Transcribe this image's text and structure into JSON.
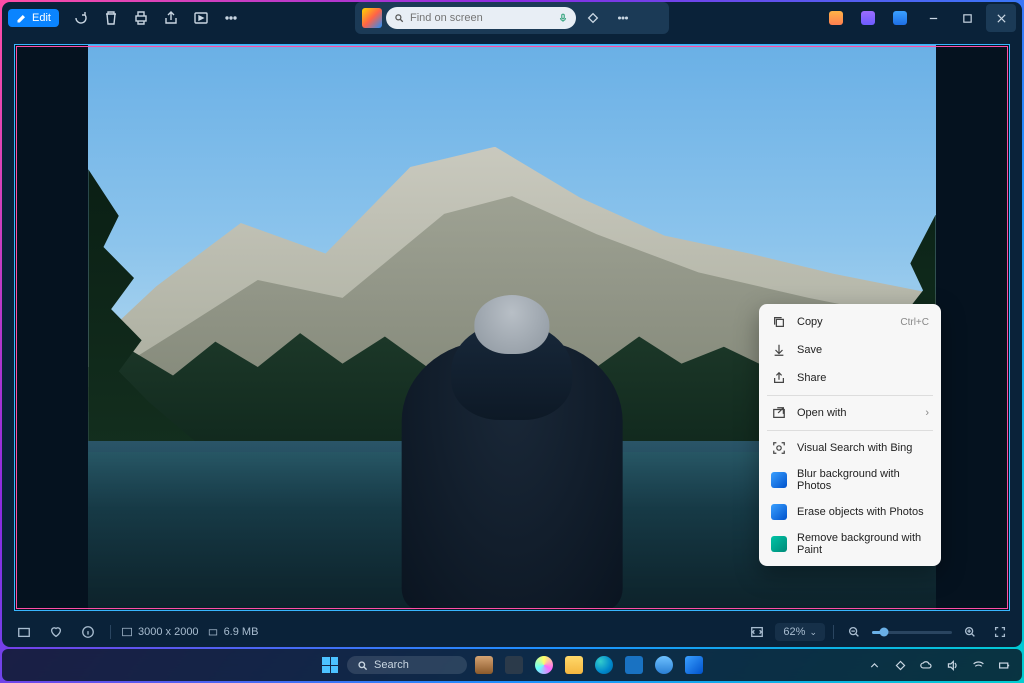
{
  "titlebar": {
    "edit_label": "Edit",
    "search_placeholder": "Find on screen"
  },
  "context_menu": {
    "copy": "Copy",
    "copy_shortcut": "Ctrl+C",
    "save": "Save",
    "share": "Share",
    "open_with": "Open with",
    "visual_search": "Visual Search with Bing",
    "blur_bg": "Blur background with Photos",
    "erase_objects": "Erase objects with Photos",
    "remove_bg": "Remove background with Paint"
  },
  "statusbar": {
    "dimensions": "3000 x 2000",
    "filesize": "6.9 MB",
    "zoom": "62%"
  },
  "taskbar": {
    "search_label": "Search"
  },
  "colors": {
    "photos_blue": "#0078d4",
    "paint_teal": "#00a4a6"
  }
}
